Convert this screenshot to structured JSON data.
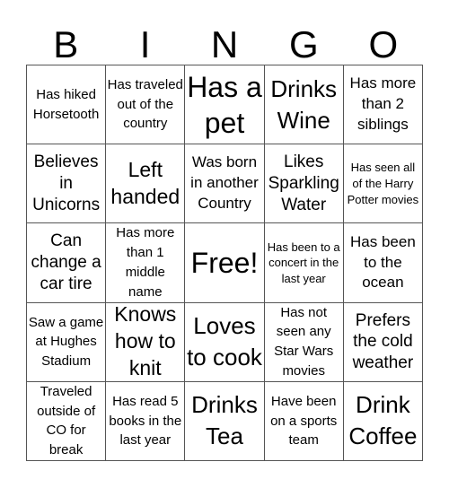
{
  "header": [
    "B",
    "I",
    "N",
    "G",
    "O"
  ],
  "board": [
    [
      "Has hiked Horsetooth",
      "Has traveled out of the country",
      "Has a pet",
      "Drinks Wine",
      "Has more than 2 siblings"
    ],
    [
      "Believes in Unicorns",
      "Left handed",
      "Was born in another Country",
      "Likes Sparkling Water",
      "Has seen all of the Harry Potter movies"
    ],
    [
      "Can change a car tire",
      "Has more than 1 middle name",
      "Free!",
      "Has been to a concert in the last year",
      "Has been to the ocean"
    ],
    [
      "Saw a game at Hughes Stadium",
      "Knows how to knit",
      "Loves to cook",
      "Has not seen any Star Wars movies",
      "Prefers the cold weather"
    ],
    [
      "Traveled outside of CO for break",
      "Has read 5 books in the last year",
      "Drinks Tea",
      "Have been on a sports team",
      "Drink Coffee"
    ]
  ]
}
